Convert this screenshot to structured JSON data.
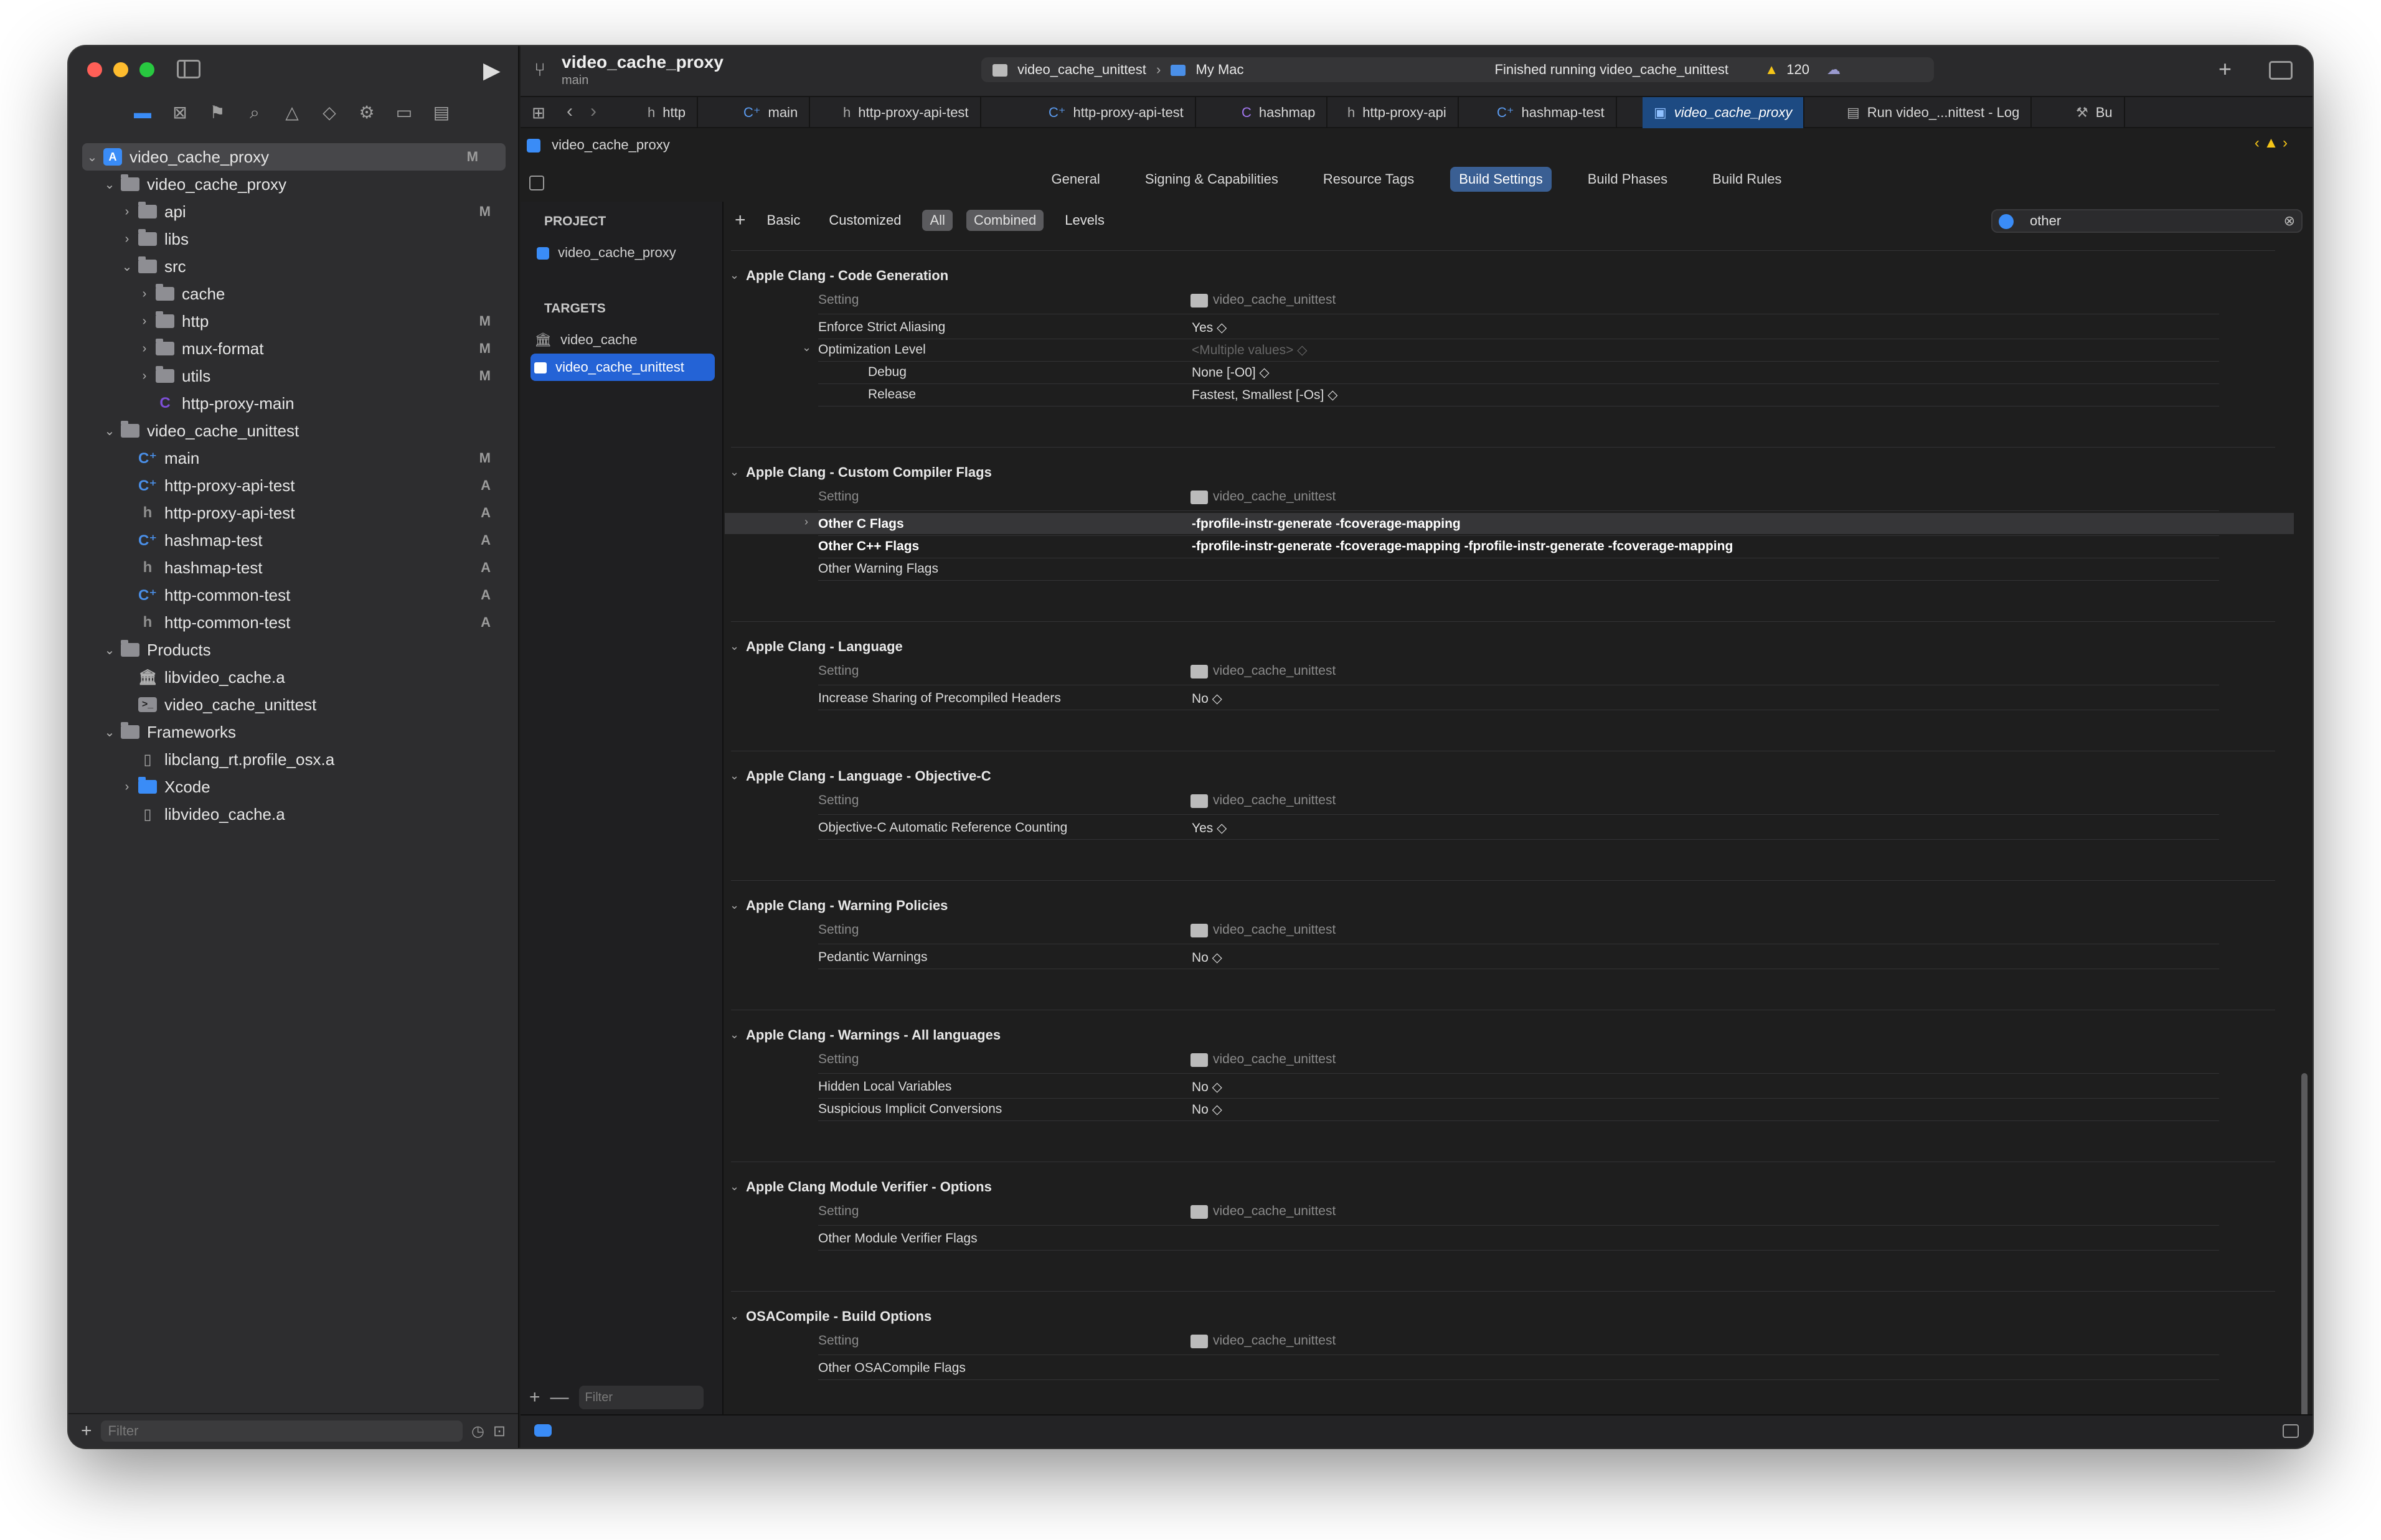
{
  "colors": {
    "accent": "#3a8cf7",
    "close": "#ff5f57",
    "minimize": "#febc2e",
    "zoom": "#28c840",
    "warning": "#f5c518"
  },
  "navigator": {
    "items": [
      {
        "label": "video_cache_proxy",
        "badge": "M",
        "icon": "project",
        "indent": 0,
        "chev": "v",
        "selected": true
      },
      {
        "label": "video_cache_proxy",
        "badge": "",
        "icon": "folder",
        "indent": 1,
        "chev": "v"
      },
      {
        "label": "api",
        "badge": "M",
        "icon": "folder",
        "indent": 2,
        "chev": ">"
      },
      {
        "label": "libs",
        "badge": "",
        "icon": "folder",
        "indent": 2,
        "chev": ">"
      },
      {
        "label": "src",
        "badge": "",
        "icon": "folder",
        "indent": 2,
        "chev": "v"
      },
      {
        "label": "cache",
        "badge": "",
        "icon": "folder",
        "indent": 3,
        "chev": ">"
      },
      {
        "label": "http",
        "badge": "M",
        "icon": "folder",
        "indent": 3,
        "chev": ">"
      },
      {
        "label": "mux-format",
        "badge": "M",
        "icon": "folder",
        "indent": 3,
        "chev": ">"
      },
      {
        "label": "utils",
        "badge": "M",
        "icon": "folder",
        "indent": 3,
        "chev": ">"
      },
      {
        "label": "http-proxy-main",
        "badge": "",
        "icon": "c",
        "indent": 3,
        "chev": ""
      },
      {
        "label": "video_cache_unittest",
        "badge": "",
        "icon": "folder",
        "indent": 1,
        "chev": "v"
      },
      {
        "label": "main",
        "badge": "M",
        "icon": "cpp",
        "indent": 2,
        "chev": ""
      },
      {
        "label": "http-proxy-api-test",
        "badge": "A",
        "icon": "cpp",
        "indent": 2,
        "chev": ""
      },
      {
        "label": "http-proxy-api-test",
        "badge": "A",
        "icon": "h",
        "indent": 2,
        "chev": ""
      },
      {
        "label": "hashmap-test",
        "badge": "A",
        "icon": "cpp",
        "indent": 2,
        "chev": ""
      },
      {
        "label": "hashmap-test",
        "badge": "A",
        "icon": "h",
        "indent": 2,
        "chev": ""
      },
      {
        "label": "http-common-test",
        "badge": "A",
        "icon": "cpp",
        "indent": 2,
        "chev": ""
      },
      {
        "label": "http-common-test",
        "badge": "A",
        "icon": "h",
        "indent": 2,
        "chev": ""
      },
      {
        "label": "Products",
        "badge": "",
        "icon": "folder",
        "indent": 1,
        "chev": "v"
      },
      {
        "label": "libvideo_cache.a",
        "badge": "",
        "icon": "lib",
        "indent": 2,
        "chev": ""
      },
      {
        "label": "video_cache_unittest",
        "badge": "",
        "icon": "term",
        "indent": 2,
        "chev": ""
      },
      {
        "label": "Frameworks",
        "badge": "",
        "icon": "folder",
        "indent": 1,
        "chev": "v"
      },
      {
        "label": "libclang_rt.profile_osx.a",
        "badge": "",
        "icon": "file",
        "indent": 2,
        "chev": ""
      },
      {
        "label": "Xcode",
        "badge": "",
        "icon": "bluefolder",
        "indent": 2,
        "chev": ">"
      },
      {
        "label": "libvideo_cache.a",
        "badge": "",
        "icon": "file",
        "indent": 2,
        "chev": ""
      }
    ],
    "filter_placeholder": "Filter"
  },
  "toolbar": {
    "project": "video_cache_proxy",
    "branch": "main",
    "scheme": "video_cache_unittest",
    "destination": "My Mac",
    "status": "Finished running video_cache_unittest",
    "warning_count": "120"
  },
  "tabs": [
    "http",
    "main",
    "http-proxy-api-test",
    "http-proxy-api-test",
    "hashmap",
    "http-proxy-api",
    "hashmap-test",
    "video_cache_proxy",
    "Run video_...nittest - Log",
    "Bu"
  ],
  "breadcrumb": "video_cache_proxy",
  "settings_tabs": [
    "General",
    "Signing & Capabilities",
    "Resource Tags",
    "Build Settings",
    "Build Phases",
    "Build Rules"
  ],
  "active_settings_tab": "Build Settings",
  "project_targets": {
    "project_header": "PROJECT",
    "project": "video_cache_proxy",
    "targets_header": "TARGETS",
    "targets": [
      "video_cache",
      "video_cache_unittest"
    ],
    "filter_placeholder": "Filter"
  },
  "filterbar": {
    "items": [
      "Basic",
      "Customized",
      "All",
      "Combined",
      "Levels"
    ],
    "search": "other"
  },
  "sections": [
    {
      "title": "Apple Clang - Code Generation",
      "col_setting": "Setting",
      "col_target": "video_cache_unittest",
      "rows": [
        {
          "name": "Enforce Strict Aliasing",
          "value": "Yes ◇"
        },
        {
          "name": "Optimization Level",
          "value": "<Multiple values> ◇"
        },
        {
          "name": "Debug",
          "value": "None [-O0] ◇"
        },
        {
          "name": "Release",
          "value": "Fastest, Smallest [-Os] ◇"
        }
      ]
    },
    {
      "title": "Apple Clang - Custom Compiler Flags",
      "col_setting": "Setting",
      "col_target": "video_cache_unittest",
      "rows": [
        {
          "name": "Other C Flags",
          "value": "-fprofile-instr-generate -fcoverage-mapping"
        },
        {
          "name": "Other C++ Flags",
          "value": "-fprofile-instr-generate -fcoverage-mapping -fprofile-instr-generate -fcoverage-mapping"
        },
        {
          "name": "Other Warning Flags",
          "value": ""
        }
      ]
    },
    {
      "title": "Apple Clang - Language",
      "col_setting": "Setting",
      "col_target": "video_cache_unittest",
      "rows": [
        {
          "name": "Increase Sharing of Precompiled Headers",
          "value": "No ◇"
        }
      ]
    },
    {
      "title": "Apple Clang - Language - Objective-C",
      "col_setting": "Setting",
      "col_target": "video_cache_unittest",
      "rows": [
        {
          "name": "Objective-C Automatic Reference Counting",
          "value": "Yes ◇"
        }
      ]
    },
    {
      "title": "Apple Clang - Warning Policies",
      "col_setting": "Setting",
      "col_target": "video_cache_unittest",
      "rows": [
        {
          "name": "Pedantic Warnings",
          "value": "No ◇"
        }
      ]
    },
    {
      "title": "Apple Clang - Warnings - All languages",
      "col_setting": "Setting",
      "col_target": "video_cache_unittest",
      "rows": [
        {
          "name": "Hidden Local Variables",
          "value": "No ◇"
        },
        {
          "name": "Suspicious Implicit Conversions",
          "value": "No ◇"
        }
      ]
    },
    {
      "title": "Apple Clang Module Verifier - Options",
      "col_setting": "Setting",
      "col_target": "video_cache_unittest",
      "rows": [
        {
          "name": "Other Module Verifier Flags",
          "value": ""
        }
      ]
    },
    {
      "title": "OSACompile - Build Options",
      "col_setting": "Setting",
      "col_target": "video_cache_unittest",
      "rows": [
        {
          "name": "Other OSACompile Flags",
          "value": ""
        }
      ]
    }
  ]
}
